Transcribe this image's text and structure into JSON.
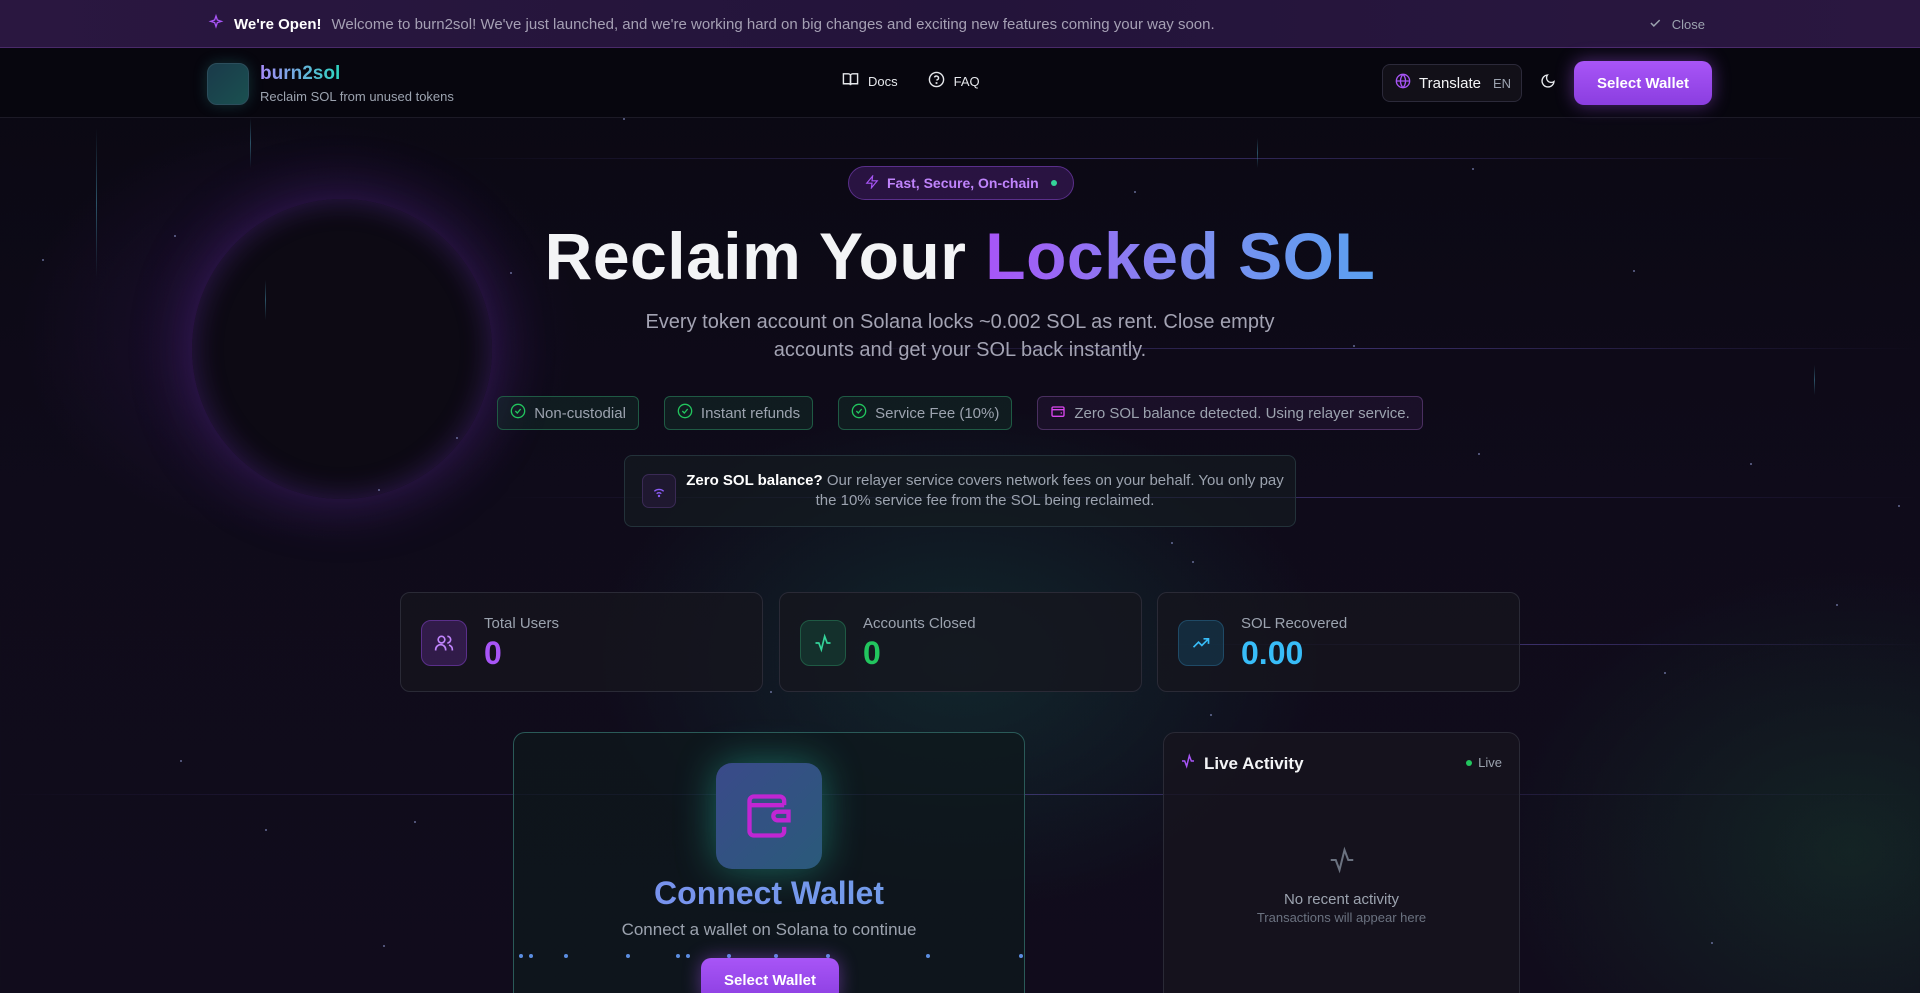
{
  "announcement": {
    "title": "We're Open!",
    "message": "Welcome to burn2sol! We've just launched, and we're working hard on big changes and exciting new features coming your way soon.",
    "close_label": "Close",
    "icon": "sparkle-icon"
  },
  "header": {
    "brand": "burn2sol",
    "tagline": "Reclaim SOL from unused tokens",
    "nav": [
      {
        "label": "Docs",
        "icon": "book-icon"
      },
      {
        "label": "FAQ",
        "icon": "help-circle-icon"
      }
    ],
    "translate_label": "Translate",
    "language": "EN",
    "theme_icon": "moon-icon",
    "wallet_button": "Select Wallet"
  },
  "hero": {
    "pill": "Fast, Secure, On-chain",
    "title_plain": "Reclaim Your",
    "title_highlight": "Locked SOL",
    "subtitle": "Every token account on Solana locks ~0.002 SOL as rent. Close empty accounts and get your SOL back instantly.",
    "badges": [
      {
        "label": "Non-custodial",
        "icon": "check-circle-icon"
      },
      {
        "label": "Instant refunds",
        "icon": "check-circle-icon"
      },
      {
        "label": "Service Fee (10%)",
        "icon": "check-circle-icon"
      },
      {
        "label": "Zero SOL balance detected. Using relayer service.",
        "icon": "wallet-icon"
      }
    ],
    "relayer": {
      "title": "Zero SOL balance?",
      "text": "Our relayer service covers network fees on your behalf. You only pay the 10% service fee from the SOL being reclaimed."
    }
  },
  "stats": [
    {
      "label": "Total Users",
      "value": "0",
      "color": "#a855f7",
      "icon": "users-icon"
    },
    {
      "label": "Accounts Closed",
      "value": "0",
      "color": "#22c55e",
      "icon": "activity-icon"
    },
    {
      "label": "SOL Recovered",
      "value": "0.00",
      "color": "#38bdf8",
      "icon": "trending-up-icon"
    }
  ],
  "connect": {
    "title": "Connect Wallet",
    "subtitle": "Connect a wallet on Solana to continue",
    "button": "Select Wallet"
  },
  "live_activity": {
    "title": "Live Activity",
    "status": "Live",
    "empty_title": "No recent activity",
    "empty_subtitle": "Transactions will appear here"
  },
  "colors": {
    "accent": "#a855f7",
    "success": "#22c55e",
    "info": "#38bdf8"
  }
}
